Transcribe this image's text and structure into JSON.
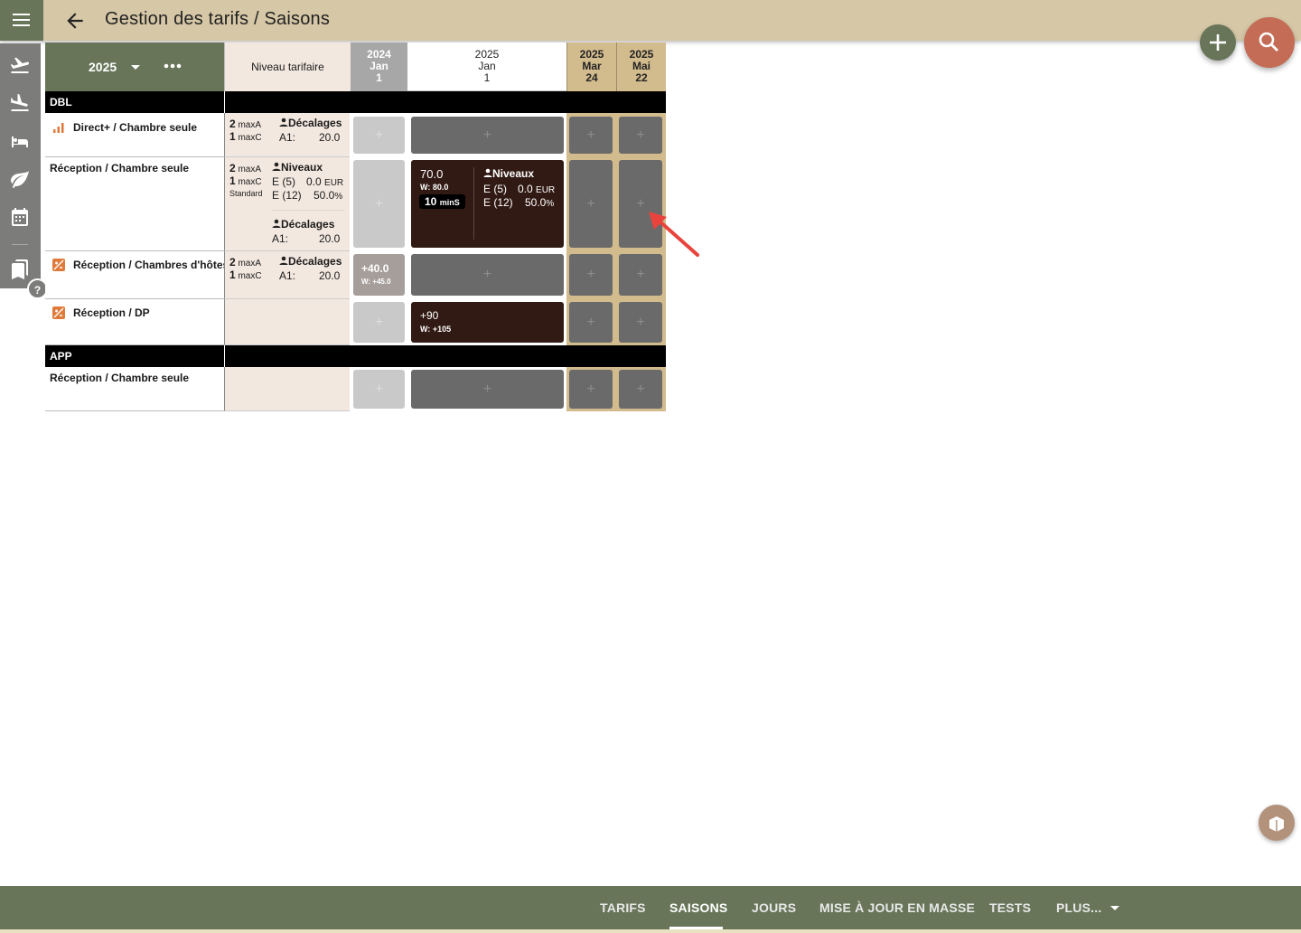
{
  "header": {
    "title": "Gestion des tarifs / Saisons"
  },
  "toolbar": {
    "year": "2025",
    "niveau_header": "Niveau tarifaire"
  },
  "columns": [
    {
      "y": "2024",
      "m": "Jan",
      "d": "1"
    },
    {
      "y": "2025",
      "m": "Jan",
      "d": "1"
    },
    {
      "y": "2025",
      "m": "Mar",
      "d": "24"
    },
    {
      "y": "2025",
      "m": "Mai",
      "d": "22"
    }
  ],
  "sections": {
    "dbl": "DBL",
    "app": "APP"
  },
  "rows": {
    "r1": {
      "label": "Direct+ / Chambre seule",
      "maxA": "2",
      "maxC": "1",
      "maxA_lbl": "maxA",
      "maxC_lbl": "maxC",
      "dec_title": "Décalages",
      "a1_key": "A1:",
      "a1_val": "20.0"
    },
    "r2": {
      "label": "Réception / Chambre seule",
      "maxA": "2",
      "maxC": "1",
      "maxA_lbl": "maxA",
      "maxC_lbl": "maxC",
      "standard": "Standard",
      "niv_title": "Niveaux",
      "e5_key": "E (5)",
      "e5_val": "0.0",
      "eur": "EUR",
      "e12_key": "E (12)",
      "e12_val": "50.0",
      "pct": "%",
      "dec_title": "Décalages",
      "a1_key": "A1:",
      "a1_val": "20.0",
      "price": "70.0",
      "w": "W: 80.0",
      "min_n": "10",
      "min_lbl": "minS",
      "c_niv_title": "Niveaux",
      "c_e5_key": "E (5)",
      "c_e5_val": "0.0",
      "c_eur": "EUR",
      "c_e12_key": "E (12)",
      "c_e12_val": "50.0",
      "c_pct": "%"
    },
    "r3": {
      "label": "Réception / Chambres d'hôtes",
      "maxA": "2",
      "maxC": "1",
      "maxA_lbl": "maxA",
      "maxC_lbl": "maxC",
      "dec_title": "Décalages",
      "a1_key": "A1:",
      "a1_val": "20.0",
      "v1": "+40.0",
      "w1": "W: +45.0"
    },
    "r4": {
      "label": "Réception / DP",
      "v": "+90",
      "w": "W: +105"
    },
    "r5": {
      "label": "Réception / Chambre seule"
    }
  },
  "plus_glyph": "+",
  "help": "?",
  "tabs": [
    "TARIFS",
    "SAISONS",
    "JOURS",
    "MISE À JOUR EN MASSE",
    "TESTS",
    "PLUS..."
  ],
  "colors": {
    "olive": "#687559",
    "tan": "#d6c7a6",
    "chocolate": "#321a14",
    "search": "#c46c55",
    "arrow": "#e8433d"
  }
}
